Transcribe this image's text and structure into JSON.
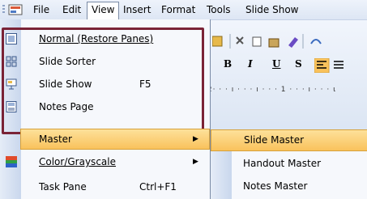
{
  "menubar": {
    "items": [
      {
        "label": "File"
      },
      {
        "label": "Edit"
      },
      {
        "label": "View"
      },
      {
        "label": "Insert"
      },
      {
        "label": "Format"
      },
      {
        "label": "Tools"
      },
      {
        "label": "Slide Show"
      }
    ]
  },
  "toolbar": {
    "bold": "B",
    "italic": "I",
    "underline": "U",
    "shadow": "S",
    "ruler": "·2· · · ı · · · ı · · · 1 · · · ı · · · ɩ"
  },
  "view_menu": {
    "items": [
      {
        "label": "Normal (Restore Panes)",
        "icon": "normal-view-icon"
      },
      {
        "label": "Slide Sorter",
        "icon": "slide-sorter-icon"
      },
      {
        "label": "Slide Show",
        "shortcut": "F5",
        "icon": "slide-show-icon"
      },
      {
        "label": "Notes Page",
        "icon": "notes-page-icon"
      },
      {
        "label": "Master"
      },
      {
        "label": "Color/Grayscale",
        "icon": "color-grayscale-icon"
      },
      {
        "label": "Task Pane",
        "shortcut": "Ctrl+F1"
      }
    ]
  },
  "master_submenu": {
    "items": [
      {
        "label": "Slide Master"
      },
      {
        "label": "Handout Master"
      },
      {
        "label": "Notes Master"
      }
    ]
  },
  "colors": {
    "highlight_border": "#7a2336",
    "selected_fill": "#f9c25c"
  }
}
